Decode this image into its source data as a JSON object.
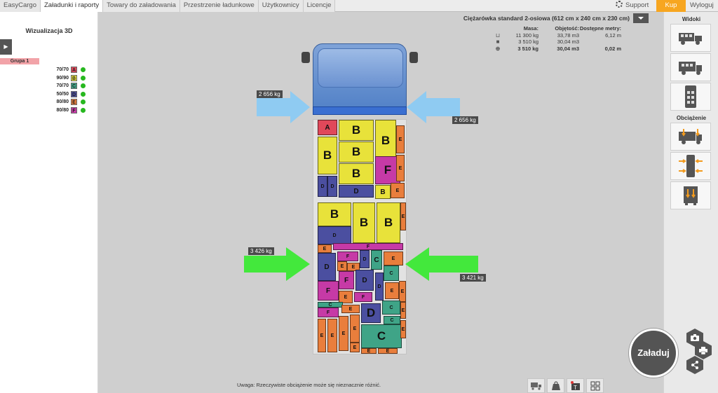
{
  "menu": [
    "EasyCargo",
    "Załadunki i raporty",
    "Towary do załadowania",
    "Przestrzenie ładunkowe",
    "Użytkownicy",
    "Licencje"
  ],
  "topright": {
    "support": "Support",
    "buy": "Kup",
    "logout": "Wyloguj"
  },
  "left": {
    "title": "Wizualizacja 3D",
    "group": "Grupa 1",
    "items": [
      {
        "count": "70/70",
        "letter": "A",
        "color": "#e0485a"
      },
      {
        "count": "90/90",
        "letter": "B",
        "color": "#e8e23a"
      },
      {
        "count": "70/70",
        "letter": "C",
        "color": "#3fa487"
      },
      {
        "count": "50/50",
        "letter": "D",
        "color": "#4b4fa0"
      },
      {
        "count": "80/80",
        "letter": "E",
        "color": "#e97e3c"
      },
      {
        "count": "80/80",
        "letter": "F",
        "color": "#c63aa6"
      }
    ]
  },
  "info": {
    "title": "Ciężarówka standard 2-osiowa (612 cm x 240 cm x 230 cm)",
    "headers": [
      "Masa:",
      "Objętość:",
      "Dostępne metry:"
    ],
    "rows": [
      {
        "icon": "truck-scale-icon",
        "glyph": "⊔",
        "mass": "11 300 kg",
        "volume": "33,78 m3",
        "meters": "6,12 m"
      },
      {
        "icon": "box-icon",
        "glyph": "■",
        "mass": "3 510 kg",
        "volume": "30,04 m3",
        "meters": ""
      },
      {
        "icon": "loaded-truck-icon",
        "glyph": "⊕",
        "mass": "3 510 kg",
        "volume": "30,04 m3",
        "meters": "0,02 m"
      }
    ]
  },
  "right": {
    "views_title": "Widoki",
    "load_title": "Obciążenie"
  },
  "weights": {
    "front_left": "2 656 kg",
    "front_right": "2 656 kg",
    "rear_left": "3 426 kg",
    "rear_right": "3 421 kg"
  },
  "note": "Uwaga: Rzeczywiste obciążenie może się nieznacznie różnić.",
  "load_button": "Załaduj"
}
